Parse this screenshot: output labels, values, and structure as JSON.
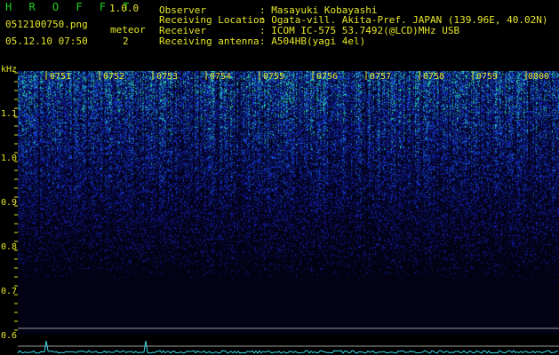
{
  "header": {
    "app_name": "H R O F F T",
    "version": "1.0.0",
    "filename": "0512100750.png",
    "datetime": "05.12.10 07:50",
    "meteor_label": "meteor",
    "meteor_count": "2",
    "info": [
      {
        "label": "Observer",
        "value": ": Masayuki Kobayashi"
      },
      {
        "label": "Receiving Location",
        "value": ": Ogata-vill. Akita-Pref. JAPAN (139.96E, 40.02N)"
      },
      {
        "label": "Receiver",
        "value": ": ICOM IC-575 53.7492(@LCD)MHz USB"
      },
      {
        "label": "Receiving antenna",
        "value": ": A504HB(yagi 4el)"
      }
    ]
  },
  "axis": {
    "unit": "kHz",
    "freq_ticks": [
      "1.1",
      "1.0",
      "0.9",
      "0.8",
      "0.7",
      "0.6"
    ],
    "time_ticks": [
      "0751",
      "0752",
      "0753",
      "0754",
      "0755",
      "0756",
      "0757",
      "0758",
      "0759",
      "0800"
    ]
  },
  "colors": {
    "text": "#e6e62a",
    "title": "#1ecf1e",
    "spectrum_dark": "#02022a",
    "spectrum_mid": "#1a2ad6",
    "spectrum_bright": "#38d6a4",
    "trace": "#3ed6e6",
    "guide_line": "#9a9a9a"
  }
}
